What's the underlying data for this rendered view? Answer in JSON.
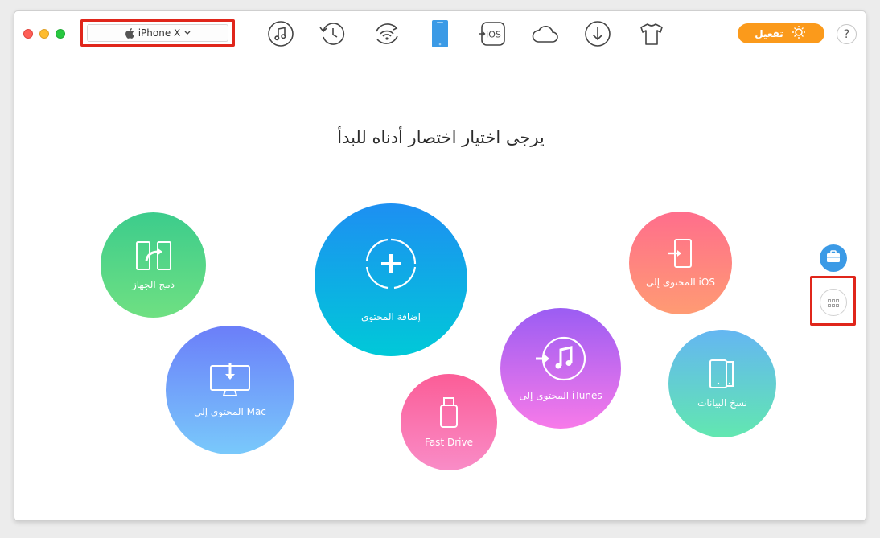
{
  "device": {
    "name": "iPhone X"
  },
  "toolbar": {
    "icons": [
      "music-icon",
      "history-icon",
      "wifi-sync-icon",
      "device-icon",
      "ios-icon",
      "cloud-icon",
      "download-icon",
      "shirt-icon"
    ]
  },
  "activate": {
    "label": "تفعيل"
  },
  "help": {
    "label": "?"
  },
  "main": {
    "headline": "يرجى اختيار اختصار أدناه للبدأ",
    "shortcuts": [
      {
        "label": "دمج الجهاز"
      },
      {
        "label": "المحتوى إلى Mac"
      },
      {
        "label": "إضافة المحتوى"
      },
      {
        "label": "Fast Drive"
      },
      {
        "label": "المحتوى إلى iTunes"
      },
      {
        "label": "المحتوى إلى iOS"
      },
      {
        "label": "نسخ البيانات"
      }
    ]
  },
  "colors": {
    "accent_orange": "#fb9a1b",
    "highlight_red": "#e0261b",
    "active_blue": "#3b9ae6"
  }
}
